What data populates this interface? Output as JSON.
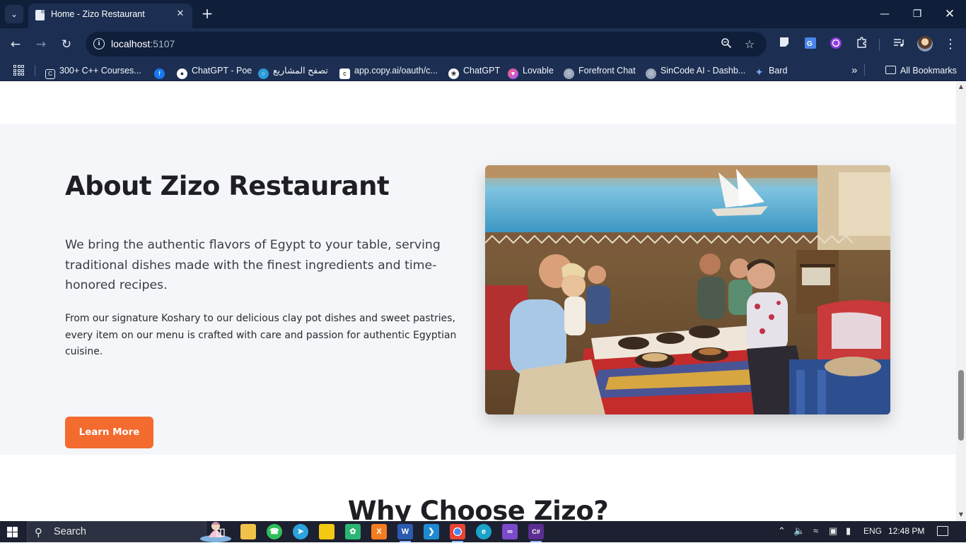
{
  "browser": {
    "tab": {
      "title": "Home - Zizo Restaurant"
    },
    "address": {
      "host": "localhost",
      "port": ":5107"
    },
    "bookmarks": [
      {
        "label": "300+ C++ Courses...",
        "icon": "courses-icon"
      },
      {
        "label": "ChatGPT - Poe",
        "icon": "poe-icon"
      },
      {
        "label": "تصفح المشاريع",
        "icon": "mostaql-icon"
      },
      {
        "label": "app.copy.ai/oauth/c...",
        "icon": "copyai-icon"
      },
      {
        "label": "ChatGPT",
        "icon": "chatgpt-icon"
      },
      {
        "label": "Lovable",
        "icon": "lovable-icon"
      },
      {
        "label": "Forefront Chat",
        "icon": "globe-icon"
      },
      {
        "label": "SinCode AI - Dashb...",
        "icon": "globe-icon"
      },
      {
        "label": "Bard",
        "icon": "bard-icon"
      }
    ],
    "all_bookmarks_label": "All Bookmarks"
  },
  "page": {
    "about": {
      "title": "About Zizo Restaurant",
      "lead": "We bring the authentic flavors of Egypt to your table, serving traditional dishes made with the finest ingredients and time-honored recipes.",
      "body": "From our signature Koshary to our delicious clay pot dishes and sweet pastries, every item on our menu is crafted with care and passion for authentic Egyptian cuisine.",
      "button_label": "Learn More"
    },
    "why": {
      "title": "Why Choose Zizo?"
    }
  },
  "taskbar": {
    "search_label": "Search",
    "language": "ENG",
    "time": "12:48 PM"
  },
  "colors": {
    "accent": "#f36b2e",
    "section_bg": "#f4f6f9",
    "chrome_dark": "#0f1f3a",
    "chrome_mid": "#1c2f52"
  }
}
